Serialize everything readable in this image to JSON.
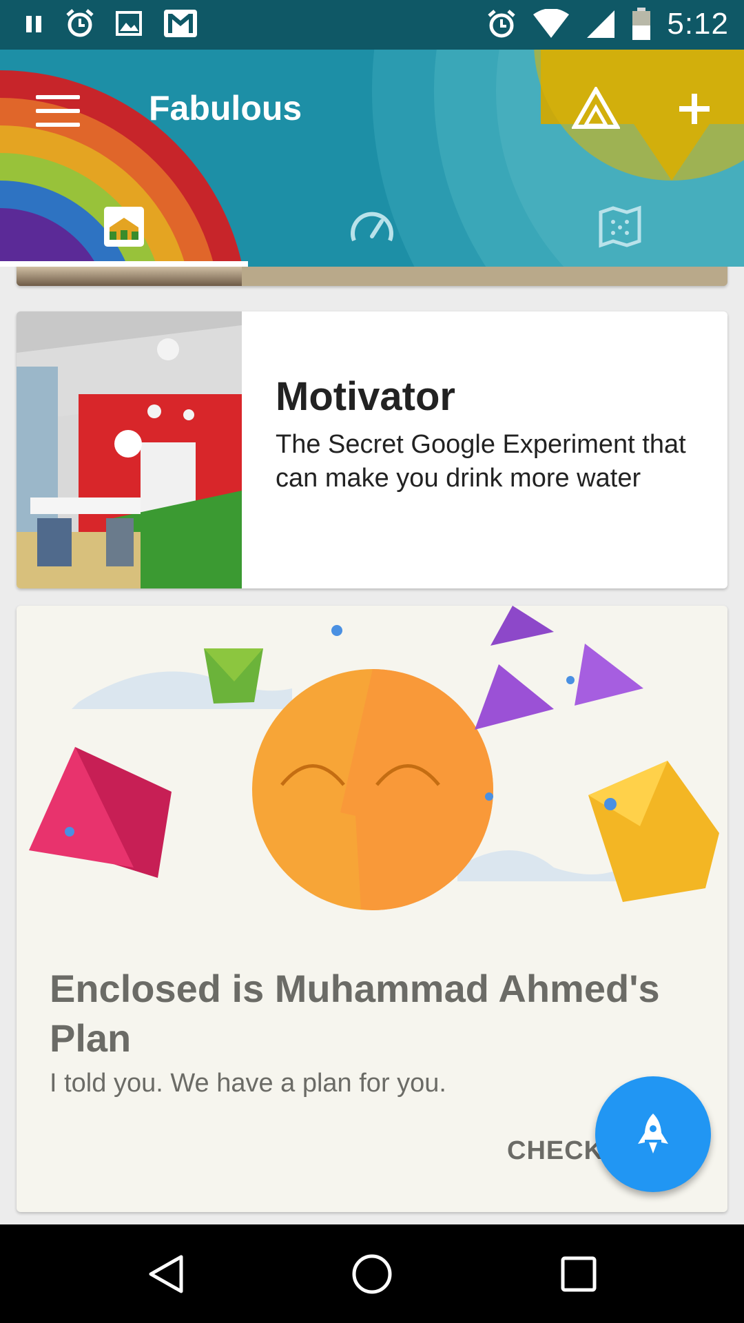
{
  "status_bar": {
    "time": "5:12",
    "left_icons": [
      "pause-icon",
      "alarm-icon",
      "image-icon",
      "gmail-icon"
    ],
    "right_icons": [
      "alarm-icon",
      "wifi-icon",
      "signal-icon",
      "battery-icon"
    ]
  },
  "app_bar": {
    "title": "Fabulous",
    "color": "#1d8fa6",
    "actions": [
      "triangle-icon",
      "plus-icon"
    ],
    "tabs": [
      {
        "name": "home",
        "icon": "home-icon",
        "selected": true
      },
      {
        "name": "stats",
        "icon": "speedometer-icon",
        "selected": false
      },
      {
        "name": "journey",
        "icon": "map-icon",
        "selected": false
      }
    ]
  },
  "cards": {
    "motivator": {
      "title": "Motivator",
      "body": "The Secret Google Experiment that can make you drink more water"
    },
    "plan": {
      "title": "Enclosed is Muhammad Ahmed's Plan",
      "subtitle": "I told you. We have a plan for you.",
      "action": "CHECK"
    }
  },
  "fab": {
    "icon": "rocket-icon",
    "color": "#2196f3"
  },
  "nav_bar": {
    "buttons": [
      "back-icon",
      "home-circle-icon",
      "recents-icon"
    ]
  }
}
